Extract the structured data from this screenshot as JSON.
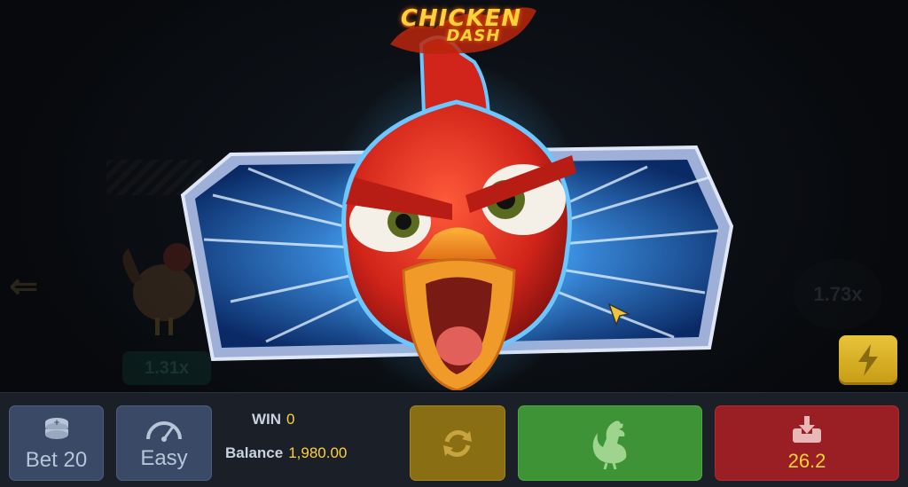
{
  "logo": {
    "line1": "CHICKEN",
    "line2": "DASH"
  },
  "background": {
    "left_multiplier": "1.31x",
    "right_multiplier": "1.73x"
  },
  "controls": {
    "bet_label": "Bet 20",
    "difficulty_label": "Easy",
    "win_label": "WIN",
    "win_value": "0",
    "balance_label": "Balance",
    "balance_value": "1,980.00",
    "cashout_value": "26.2"
  },
  "icons": {
    "bet": "coin-stack-icon",
    "difficulty": "speedometer-icon",
    "autoplay": "refresh-icon",
    "go": "rooster-icon",
    "cashout": "download-tray-icon",
    "turbo": "lightning-icon"
  },
  "colors": {
    "accent_yellow": "#ffd23a",
    "go_green": "#3d9336",
    "cashout_red": "#9a1f24",
    "panel_blue": "#3a4a66",
    "auto_gold": "#8a6e14"
  }
}
